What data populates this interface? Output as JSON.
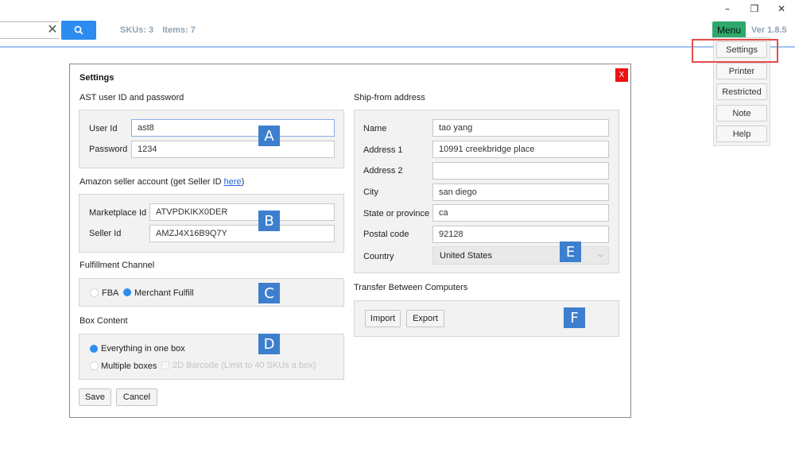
{
  "window": {
    "minimize": "–",
    "restore": "❐",
    "close": "✕"
  },
  "toolbar": {
    "search_value": "",
    "clear_glyph": "✕",
    "skus_label": "SKUs: 3",
    "items_label": "Items: 7",
    "menu_label": "Menu",
    "version": "Ver 1.8.5"
  },
  "menu": {
    "items": [
      {
        "label": "Settings"
      },
      {
        "label": "Printer"
      },
      {
        "label": "Restricted"
      },
      {
        "label": "Note"
      },
      {
        "label": "Help"
      }
    ]
  },
  "dialog": {
    "title": "Settings",
    "close_label": "X",
    "ast": {
      "section": "AST user ID and password",
      "user_id_label": "User Id",
      "user_id_value": "ast8",
      "password_label": "Password",
      "password_value": "1234"
    },
    "amazon": {
      "section_prefix": "Amazon seller account (get Seller ID ",
      "section_link": "here",
      "section_suffix": ")",
      "marketplace_label": "Marketplace Id",
      "marketplace_value": "ATVPDKIKX0DER",
      "seller_label": "Seller Id",
      "seller_value": "AMZJ4X16B9Q7Y"
    },
    "fulfillment": {
      "section": "Fulfillment Channel",
      "fba_label": "FBA",
      "merchant_label": "Merchant Fulfill",
      "selected": "Merchant Fulfill"
    },
    "box": {
      "section": "Box Content",
      "one_box_label": "Everything in one box",
      "multiple_label": "Multiple boxes",
      "barcode_label": "2D Barcode (Limit to 40 SKUs a box)",
      "selected": "Everything in one box"
    },
    "ship_from": {
      "section": "Ship-from address",
      "name_label": "Name",
      "name_value": "tao yang",
      "address1_label": "Address 1",
      "address1_value": "10991 creekbridge place",
      "address2_label": "Address 2",
      "address2_value": "",
      "city_label": "City",
      "city_value": "san diego",
      "state_label": "State or province",
      "state_value": "ca",
      "postal_label": "Postal code",
      "postal_value": "92128",
      "country_label": "Country",
      "country_value": "United States"
    },
    "transfer": {
      "section": "Transfer Between Computers",
      "import_label": "Import",
      "export_label": "Export"
    },
    "save_label": "Save",
    "cancel_label": "Cancel"
  },
  "annotations": {
    "a": "A",
    "b": "B",
    "c": "C",
    "d": "D",
    "e": "E",
    "f": "F"
  },
  "colors": {
    "accent": "#2d8cf0",
    "menu_green": "#2ea86d",
    "close_red": "#ee1111",
    "badge_blue": "#3d7fce",
    "highlight_red": "#e54c4c"
  }
}
